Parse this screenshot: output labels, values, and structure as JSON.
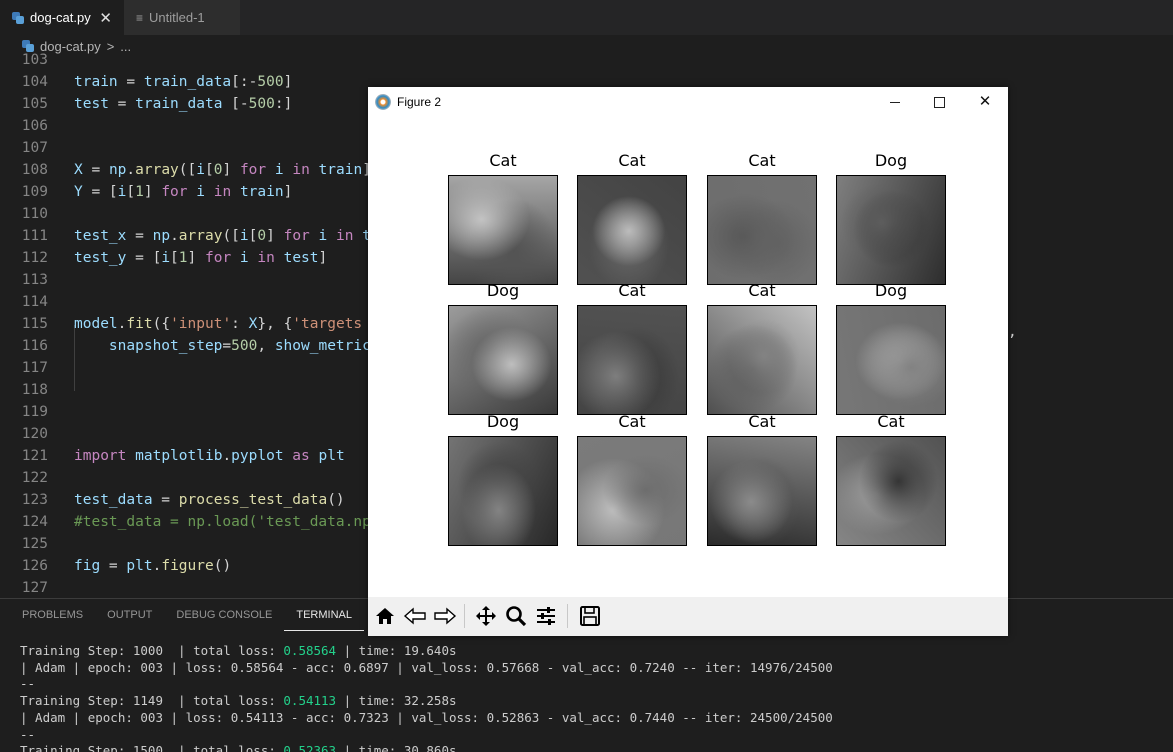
{
  "tabs": [
    {
      "label": "dog-cat.py",
      "close": "✕"
    },
    {
      "label": "Untitled-1"
    }
  ],
  "breadcrumb": {
    "file": "dog-cat.py",
    "sep": ">",
    "rest": "..."
  },
  "code_lines": [
    {
      "num": "103",
      "html": ""
    },
    {
      "num": "104",
      "html": "<span class='v'>train</span> = <span class='v'>train_data</span>[:-<span class='n'>500</span>]"
    },
    {
      "num": "105",
      "html": "<span class='v'>test</span> = <span class='v'>train_data</span> [-<span class='n'>500</span>:]"
    },
    {
      "num": "106",
      "html": ""
    },
    {
      "num": "107",
      "html": ""
    },
    {
      "num": "108",
      "html": "<span class='v'>X</span> = <span class='v'>np</span>.<span class='f'>array</span>([<span class='v'>i</span>[<span class='n'>0</span>] <span class='k'>for</span> <span class='v'>i</span> <span class='k'>in</span> <span class='v'>train</span>]"
    },
    {
      "num": "109",
      "html": "<span class='v'>Y</span> = [<span class='v'>i</span>[<span class='n'>1</span>] <span class='k'>for</span> <span class='v'>i</span> <span class='k'>in</span> <span class='v'>train</span>]"
    },
    {
      "num": "110",
      "html": ""
    },
    {
      "num": "111",
      "html": "<span class='v'>test_x</span> = <span class='v'>np</span>.<span class='f'>array</span>([<span class='v'>i</span>[<span class='n'>0</span>] <span class='k'>for</span> <span class='v'>i</span> <span class='k'>in</span> <span class='v'>t</span>"
    },
    {
      "num": "112",
      "html": "<span class='v'>test_y</span> = [<span class='v'>i</span>[<span class='n'>1</span>] <span class='k'>for</span> <span class='v'>i</span> <span class='k'>in</span> <span class='v'>test</span>]"
    },
    {
      "num": "113",
      "html": ""
    },
    {
      "num": "114",
      "html": ""
    },
    {
      "num": "115",
      "html": "<span class='v'>model</span>.<span class='f'>fit</span>({<span class='s'>'input'</span>: <span class='v'>X</span>}, {<span class='s'>'targets</span>"
    },
    {
      "num": "116",
      "html": "    <span class='v'>snapshot_step</span>=<span class='n'>500</span>, <span class='v'>show_metric</span>"
    },
    {
      "num": "117",
      "html": ""
    },
    {
      "num": "118",
      "html": ""
    },
    {
      "num": "119",
      "html": ""
    },
    {
      "num": "120",
      "html": ""
    },
    {
      "num": "121",
      "html": "<span class='k'>import</span> <span class='v'>matplotlib</span>.<span class='v'>pyplot</span> <span class='k'>as</span> <span class='v'>plt</span>"
    },
    {
      "num": "122",
      "html": ""
    },
    {
      "num": "123",
      "html": "<span class='v'>test_data</span> = <span class='f'>process_test_data</span>()"
    },
    {
      "num": "124",
      "html": "<span class='c'>#test_data = np.load('test_data.np</span>"
    },
    {
      "num": "125",
      "html": ""
    },
    {
      "num": "126",
      "html": "<span class='v'>fig</span> = <span class='v'>plt</span>.<span class='f'>figure</span>()"
    },
    {
      "num": "127",
      "html": ""
    }
  ],
  "trailing_char": ",",
  "panel_tabs": [
    "PROBLEMS",
    "OUTPUT",
    "DEBUG CONSOLE",
    "TERMINAL"
  ],
  "terminal_html": "Training Step: 1000  | total loss: <span class='hl'>0.58564</span> | time: 19.640s\n| Adam | epoch: 003 | loss: 0.58564 - acc: 0.6897 | val_loss: 0.57668 - val_acc: 0.7240 -- iter: 14976/24500\n--\nTraining Step: 1149  | total loss: <span class='hl'>0.54113</span> | time: 32.258s\n| Adam | epoch: 003 | loss: 0.54113 - acc: 0.7323 | val_loss: 0.52863 - val_acc: 0.7440 -- iter: 24500/24500\n--\nTraining Step: 1500  | total loss: <span class='hl'>0.52363</span> | time: 30.860s",
  "figure": {
    "title": "Figure 2",
    "panels": [
      {
        "label": "Cat"
      },
      {
        "label": "Cat"
      },
      {
        "label": "Cat"
      },
      {
        "label": "Dog"
      },
      {
        "label": "Dog"
      },
      {
        "label": "Cat"
      },
      {
        "label": "Cat"
      },
      {
        "label": "Dog"
      },
      {
        "label": "Dog"
      },
      {
        "label": "Cat"
      },
      {
        "label": "Cat"
      },
      {
        "label": "Cat"
      }
    ],
    "toolbar": [
      "home-icon",
      "back-icon",
      "forward-icon",
      "pan-icon",
      "zoom-icon",
      "configure-icon",
      "save-icon"
    ]
  }
}
